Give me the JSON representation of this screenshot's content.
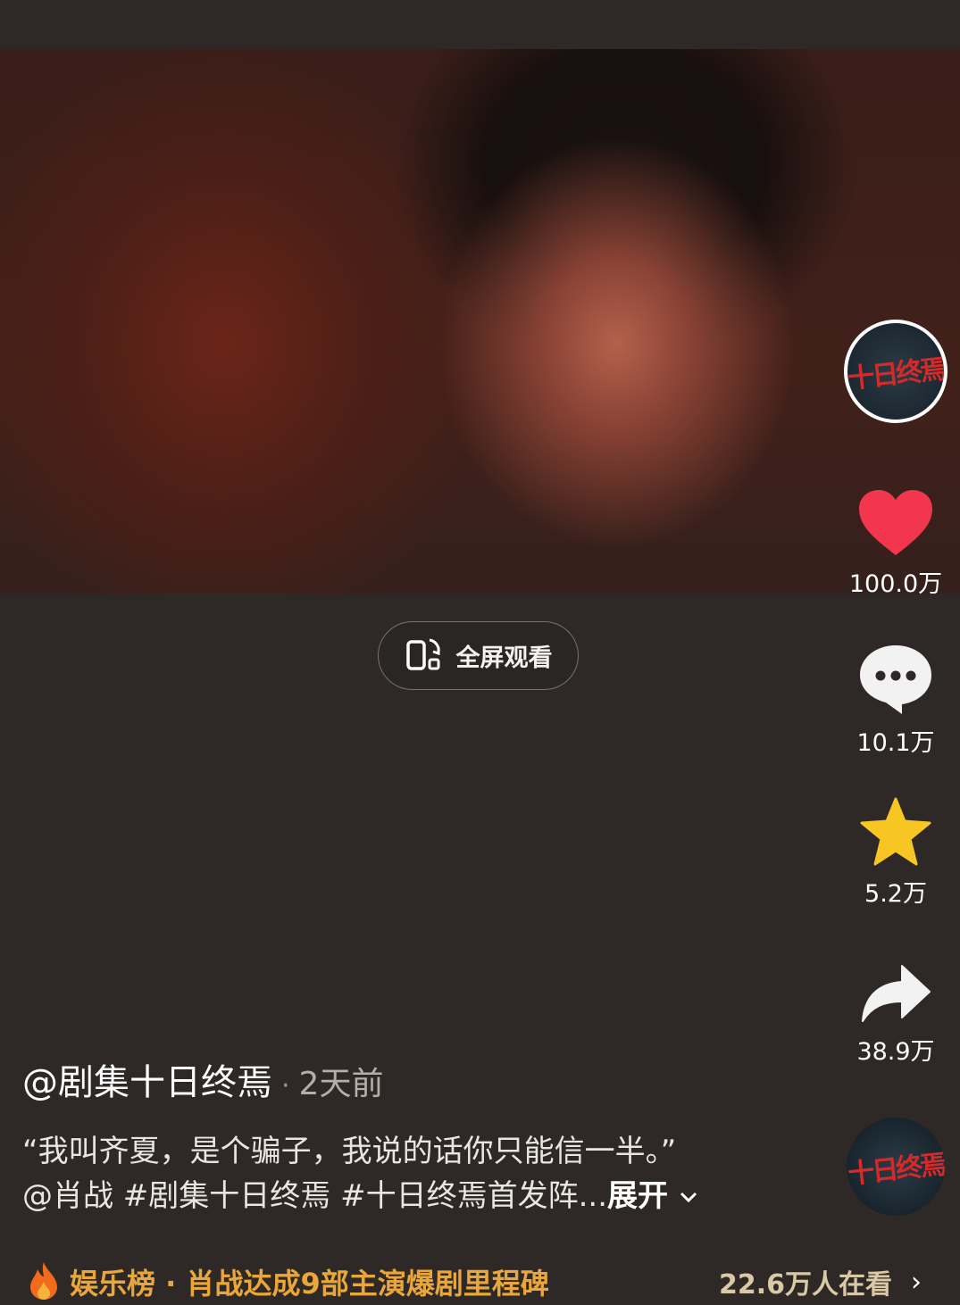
{
  "video": {
    "fullscreen_label": "全屏观看"
  },
  "sidebar": {
    "avatar_logo": "十日终焉",
    "likes": "100.0万",
    "comments": "10.1万",
    "favorites": "5.2万",
    "shares": "38.9万"
  },
  "post": {
    "author": "@剧集十日终焉",
    "separator": "·",
    "time": "2天前",
    "quote": "“我叫齐夏，是个骗子，我说的话你只能信一半。”",
    "tags": "@肖战 #剧集十日终焉 #十日终焉首发阵...",
    "expand": "展开"
  },
  "bottom": {
    "hot_label": "娱乐榜 · 肖战达成9部主演爆剧里程碑",
    "views": "22.6万人在看",
    "arrow": "›"
  },
  "colors": {
    "like": "#f2364d",
    "star": "#f8c623",
    "hot": "#e9a73b",
    "background": "#2e2926"
  }
}
